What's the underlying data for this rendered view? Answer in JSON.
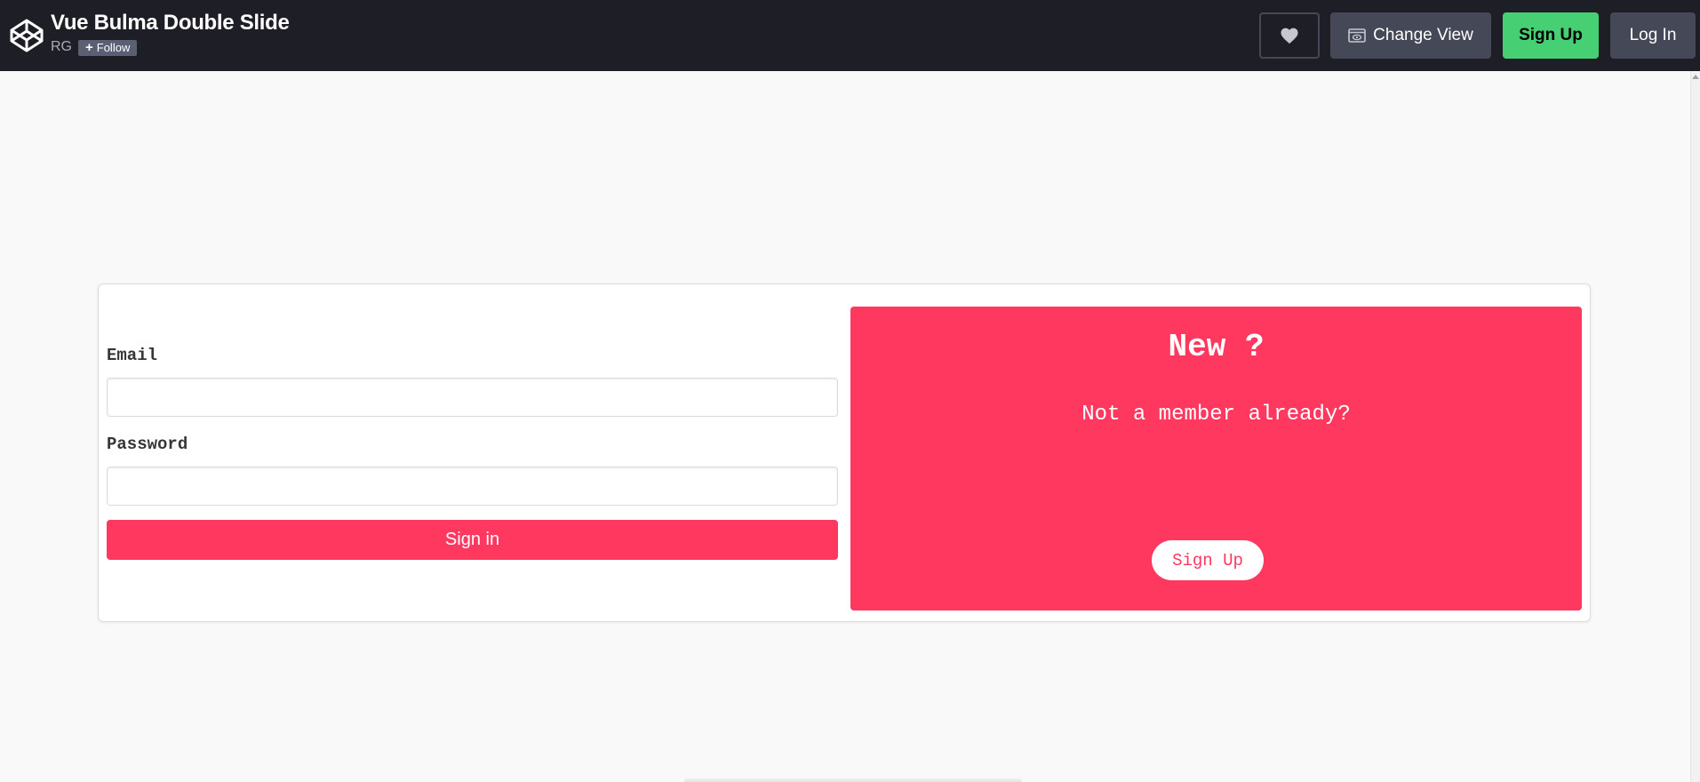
{
  "header": {
    "logo_icon": "codepen-logo-icon",
    "title": "Vue Bulma Double Slide",
    "author": "RG",
    "follow_label": "Follow",
    "heart_icon": "heart-icon",
    "change_view_label": "Change View",
    "change_view_icon": "eye-window-icon",
    "signup_label": "Sign Up",
    "login_label": "Log In",
    "colors": {
      "bar": "#1e1f26",
      "button": "#444857",
      "signup": "#47cf73"
    }
  },
  "login_form": {
    "email_label": "Email",
    "email_value": "",
    "password_label": "Password",
    "password_value": "",
    "signin_label": "Sign in"
  },
  "signup_panel": {
    "title": "New ?",
    "subtitle": "Not a member already?",
    "button_label": "Sign Up",
    "accent_color": "#ff3860"
  }
}
